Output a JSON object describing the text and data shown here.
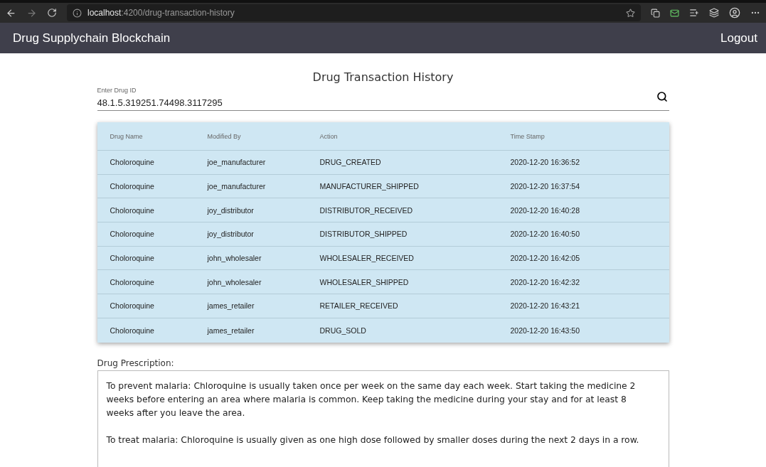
{
  "browser": {
    "url_host": "localhost",
    "url_path": ":4200/drug-transaction-history"
  },
  "app_bar": {
    "title": "Drug Supplychain Blockchain",
    "logout": "Logout"
  },
  "page_title": "Drug Transaction History",
  "search": {
    "label": "Enter Drug ID",
    "value": "48.1.5.319251.74498.3117295"
  },
  "table": {
    "columns": [
      "Drug Name",
      "Modified By",
      "Action",
      "Time Stamp"
    ],
    "rows": [
      [
        "Choloroquine",
        "joe_manufacturer",
        "DRUG_CREATED",
        "2020-12-20 16:36:52"
      ],
      [
        "Choloroquine",
        "joe_manufacturer",
        "MANUFACTURER_SHIPPED",
        "2020-12-20 16:37:54"
      ],
      [
        "Choloroquine",
        "joy_distributor",
        "DISTRIBUTOR_RECEIVED",
        "2020-12-20 16:40:28"
      ],
      [
        "Choloroquine",
        "joy_distributor",
        "DISTRIBUTOR_SHIPPED",
        "2020-12-20 16:40:50"
      ],
      [
        "Choloroquine",
        "john_wholesaler",
        "WHOLESALER_RECEIVED",
        "2020-12-20 16:42:05"
      ],
      [
        "Choloroquine",
        "john_wholesaler",
        "WHOLESALER_SHIPPED",
        "2020-12-20 16:42:32"
      ],
      [
        "Choloroquine",
        "james_retailer",
        "RETAILER_RECEIVED",
        "2020-12-20 16:43:21"
      ],
      [
        "Choloroquine",
        "james_retailer",
        "DRUG_SOLD",
        "2020-12-20 16:43:50"
      ]
    ]
  },
  "prescription": {
    "label": "Drug Prescription:",
    "text": "To prevent malaria: Chloroquine is usually taken once per week on the same day each week. Start taking the medicine 2 weeks before entering an area where malaria is common. Keep taking the medicine during your stay and for at least 8 weeks after you leave the area.\n\nTo treat malaria: Chloroquine is usually given as one high dose followed by smaller doses during the next 2 days in a row."
  }
}
